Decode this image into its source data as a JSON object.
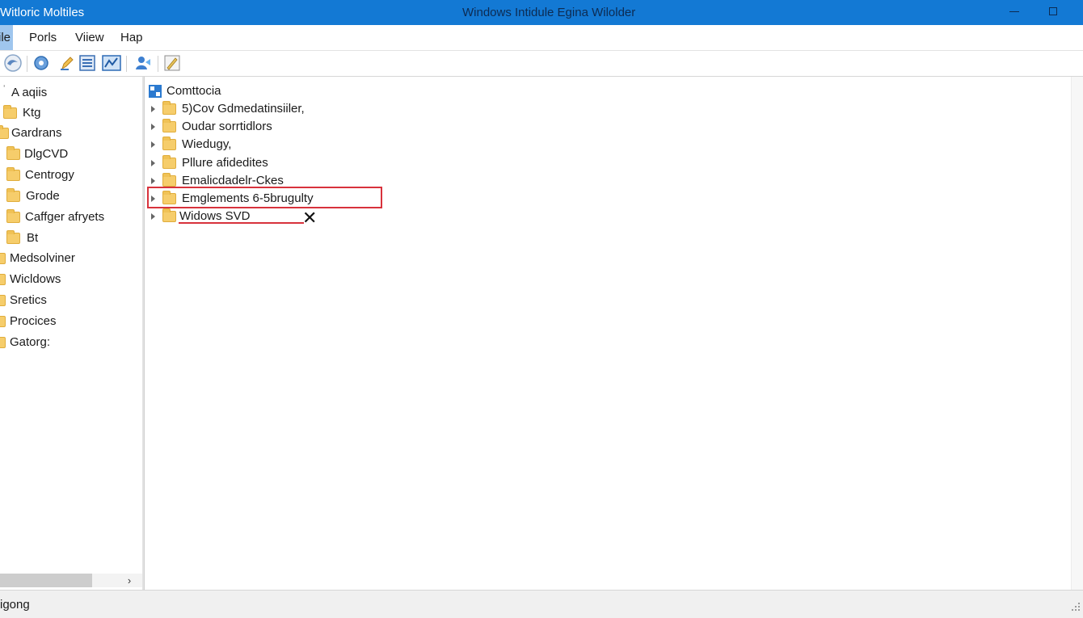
{
  "window": {
    "app_name": "Witloric Moltiles",
    "title": "Windows Intidule Egina Wilolder"
  },
  "menu": {
    "file": "ile",
    "ports": "Porls",
    "view": "Viiew",
    "help": "Hap"
  },
  "toolbar": {
    "icons": [
      "back-icon",
      "refresh-icon",
      "edit-icon",
      "details-view-icon",
      "chart-icon",
      "user-icon",
      "properties-icon"
    ]
  },
  "left_tree": {
    "items": [
      {
        "label": "A aqiis",
        "has_folder": false
      },
      {
        "label": "Ktg",
        "has_folder": true
      },
      {
        "label": "Gardrans",
        "has_folder": true
      },
      {
        "label": "DlgCVD",
        "has_folder": true
      },
      {
        "label": "Centrogy",
        "has_folder": true
      },
      {
        "label": "Grode",
        "has_folder": true
      },
      {
        "label": "Caffger afryets",
        "has_folder": true
      },
      {
        "label": "Bt",
        "has_folder": true
      },
      {
        "label": "Medsolviner",
        "has_folder": true
      },
      {
        "label": "Wicldows",
        "has_folder": true
      },
      {
        "label": "Sretics",
        "has_folder": true
      },
      {
        "label": "Procices",
        "has_folder": true
      },
      {
        "label": "Gatorg:",
        "has_folder": true
      }
    ]
  },
  "right_tree": {
    "root_label": "Comttocia",
    "items": [
      {
        "label": "5)Cov Gdmedatinsiiler,"
      },
      {
        "label": "Oudar sorrtidlors"
      },
      {
        "label": "Wiedugy,"
      },
      {
        "label": "Pllure afidedites"
      },
      {
        "label": "Emalicdadelr-Ckes"
      },
      {
        "label": "Emglements 6-5brugulty",
        "highlighted": true
      },
      {
        "label": "Widows SVD",
        "marked": true
      }
    ]
  },
  "status": {
    "text": "igong"
  },
  "colors": {
    "titlebar": "#1379d4",
    "highlight": "#d8323c",
    "folder": "#f6cd6b"
  }
}
